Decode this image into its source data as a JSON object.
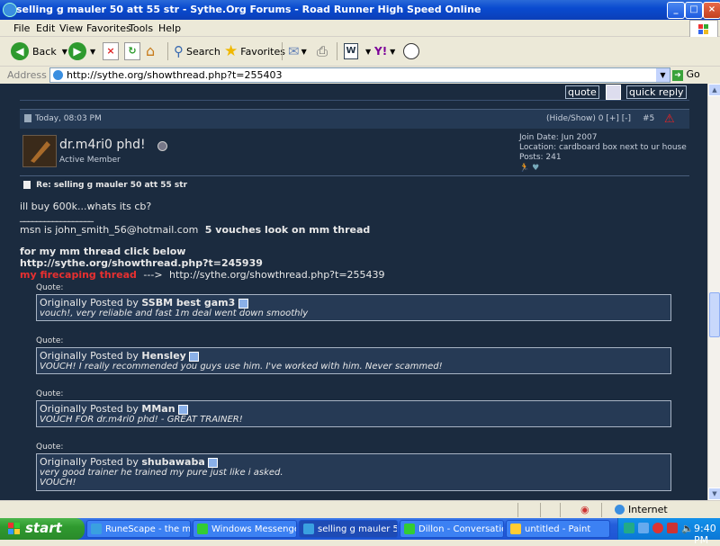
{
  "window": {
    "title": "selling g mauler 50 att 55 str - Sythe.Org Forums - Road Runner High Speed Online",
    "controls": [
      "_",
      "□",
      "×"
    ]
  },
  "menu": [
    "File",
    "Edit",
    "View",
    "Favorites",
    "Tools",
    "Help"
  ],
  "toolbar": {
    "back": "Back",
    "search": "Search",
    "favorites": "Favorites"
  },
  "address": {
    "label": "Address",
    "url": "http://sythe.org/showthread.php?t=255403",
    "go": "Go"
  },
  "forum": {
    "quote_btn": "quote",
    "quick_reply_btn": "quick reply",
    "post": {
      "date": "Today, 08:03 PM",
      "controls": "(Hide/Show) 0 [+] [-]",
      "number": "#5",
      "username": "dr.m4ri0 phd!",
      "user_title": "Active Member",
      "join_date": "Join Date: Jun 2007",
      "location": "Location: cardboard box next to ur house",
      "posts": "Posts: 241",
      "subject": "Re: selling g mauler 50 att 55 str",
      "body_line1": "ill buy 600k...whats its cb?",
      "sig_separator": "__________________",
      "sig_msn": "msn is john_smith_56@hotmail.com",
      "sig_vouches": "5 vouches look on mm thread",
      "sig_mm": "for my mm thread click below",
      "sig_mm_url": "http://sythe.org/showthread.php?t=245939",
      "sig_fire_label": "my firecaping thread",
      "sig_fire_arrow": "--->",
      "sig_fire_url": "http://sythe.org/showthread.php?t=255439"
    },
    "quotes": [
      {
        "label": "Quote:",
        "prefix": "Originally Posted by",
        "author": "SSBM best gam3",
        "text": [
          "vouch!, very reliable and fast 1m deal went down smoothly"
        ]
      },
      {
        "label": "Quote:",
        "prefix": "Originally Posted by",
        "author": "Hensley",
        "text": [
          "VOUCH! I really recommended you guys use him. I've worked with him. Never scammed!"
        ]
      },
      {
        "label": "Quote:",
        "prefix": "Originally Posted by",
        "author": "MMan",
        "text": [
          "VOUCH FOR dr.m4ri0 phd! - GREAT TRAINER!"
        ]
      },
      {
        "label": "Quote:",
        "prefix": "Originally Posted by",
        "author": "shubawaba",
        "text": [
          "very good trainer he trained my pure just like i asked.",
          "VOUCH!"
        ]
      }
    ]
  },
  "status": {
    "zone": "Internet"
  },
  "taskbar": {
    "start": "start",
    "tasks": [
      "RuneScape - the m...",
      "Windows Messenger",
      "selling g mauler 50 ...",
      "Dillon - Conversation",
      "untitled - Paint"
    ],
    "clock": "9:40 PM"
  }
}
